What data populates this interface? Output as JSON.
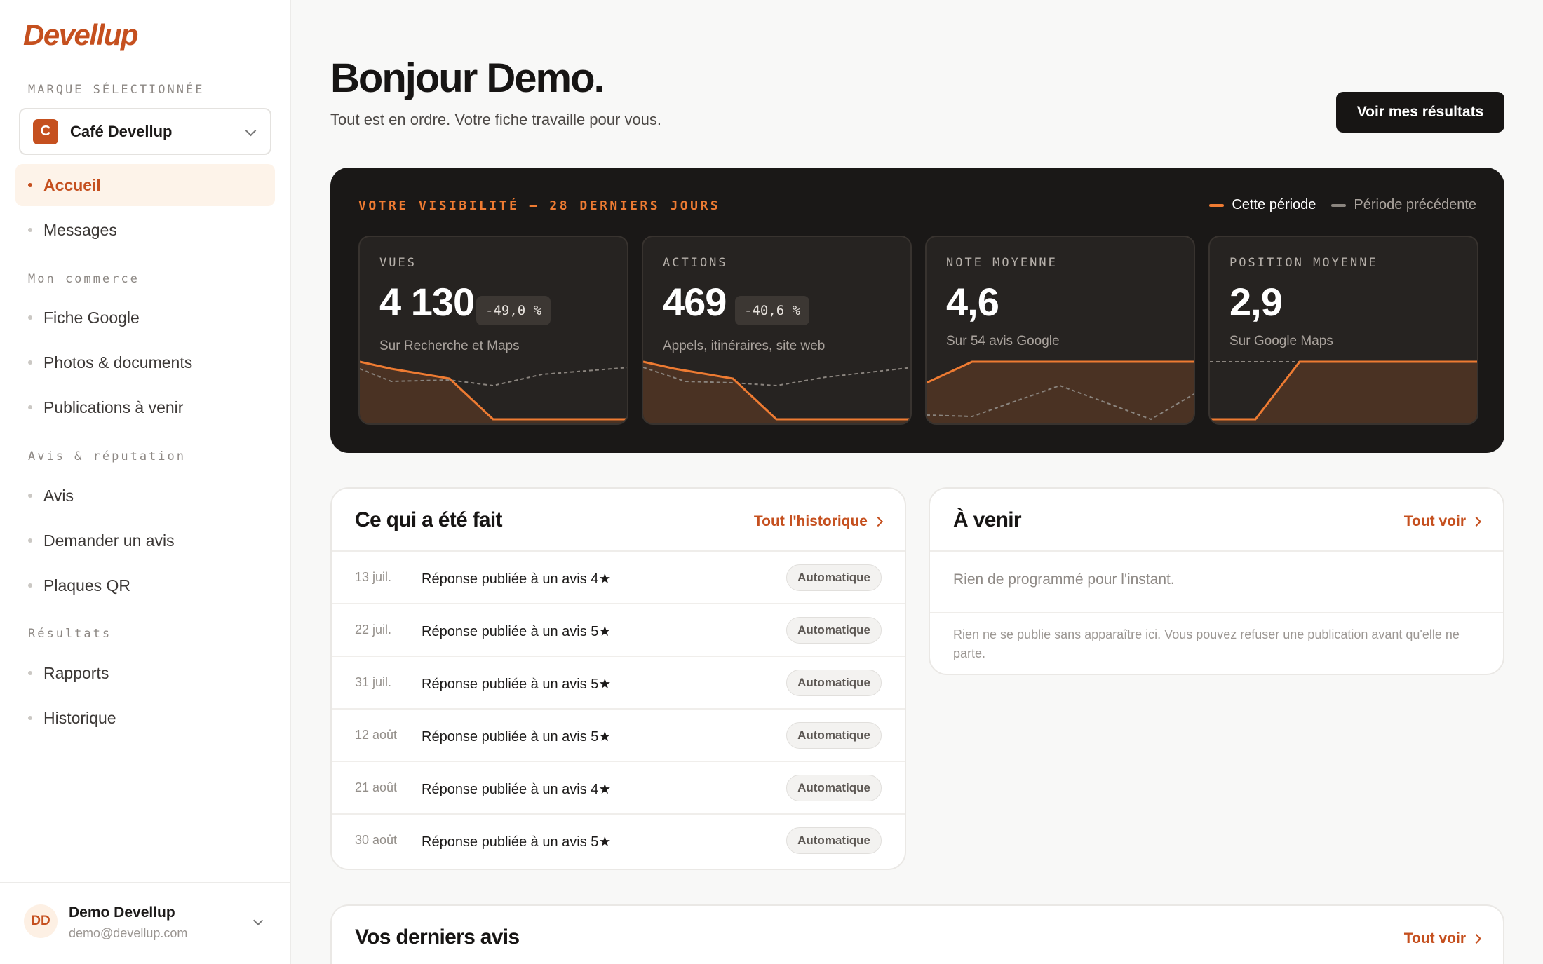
{
  "sidebar": {
    "logo": "Devellup",
    "brand_label": "MARQUE SÉLECTIONNÉE",
    "brand": {
      "initial": "C",
      "name": "Café Devellup"
    },
    "top_items": [
      {
        "label": "Accueil",
        "active": true
      },
      {
        "label": "Messages",
        "active": false
      }
    ],
    "sections": [
      {
        "title": "Mon commerce",
        "items": [
          "Fiche Google",
          "Photos & documents",
          "Publications à venir"
        ]
      },
      {
        "title": "Avis & réputation",
        "items": [
          "Avis",
          "Demander un avis",
          "Plaques QR"
        ]
      },
      {
        "title": "Résultats",
        "items": [
          "Rapports",
          "Historique"
        ]
      }
    ],
    "user": {
      "initials": "DD",
      "name": "Demo Devellup",
      "email": "demo@devellup.com"
    }
  },
  "header": {
    "title": "Bonjour Demo.",
    "subtitle": "Tout est en ordre. Votre fiche travaille pour vous.",
    "cta": "Voir mes résultats"
  },
  "visibility": {
    "title": "VOTRE VISIBILITÉ — 28 DERNIERS JOURS",
    "legend_current": "Cette période",
    "legend_previous": "Période précédente",
    "colors": {
      "accent": "#ee7b32",
      "previous": "#8a847e",
      "panel": "#1a1817"
    },
    "kpis": [
      {
        "label": "VUES",
        "value": "4 130",
        "delta": "-49,0 %",
        "sub": "Sur Recherche et Maps"
      },
      {
        "label": "ACTIONS",
        "value": "469",
        "delta": "-40,6 %",
        "sub": "Appels, itinéraires, site web"
      },
      {
        "label": "NOTE MOYENNE",
        "value": "4,6",
        "delta": "",
        "sub": "Sur 54 avis Google"
      },
      {
        "label": "POSITION MOYENNE",
        "value": "2,9",
        "delta": "",
        "sub": "Sur Google Maps"
      }
    ]
  },
  "done": {
    "title": "Ce qui a été fait",
    "link": "Tout l'historique",
    "rows": [
      {
        "date": "13 juil.",
        "text": "Réponse publiée à un avis 4★",
        "badge": "Automatique"
      },
      {
        "date": "22 juil.",
        "text": "Réponse publiée à un avis 5★",
        "badge": "Automatique"
      },
      {
        "date": "31 juil.",
        "text": "Réponse publiée à un avis 5★",
        "badge": "Automatique"
      },
      {
        "date": "12 août",
        "text": "Réponse publiée à un avis 5★",
        "badge": "Automatique"
      },
      {
        "date": "21 août",
        "text": "Réponse publiée à un avis 4★",
        "badge": "Automatique"
      },
      {
        "date": "30 août",
        "text": "Réponse publiée à un avis 5★",
        "badge": "Automatique"
      }
    ]
  },
  "upcoming": {
    "title": "À venir",
    "link": "Tout voir",
    "empty": "Rien de programmé pour l'instant.",
    "note": "Rien ne se publie sans apparaître ici. Vous pouvez refuser une publication avant qu'elle ne parte."
  },
  "reviews": {
    "title": "Vos derniers avis",
    "link": "Tout voir"
  }
}
